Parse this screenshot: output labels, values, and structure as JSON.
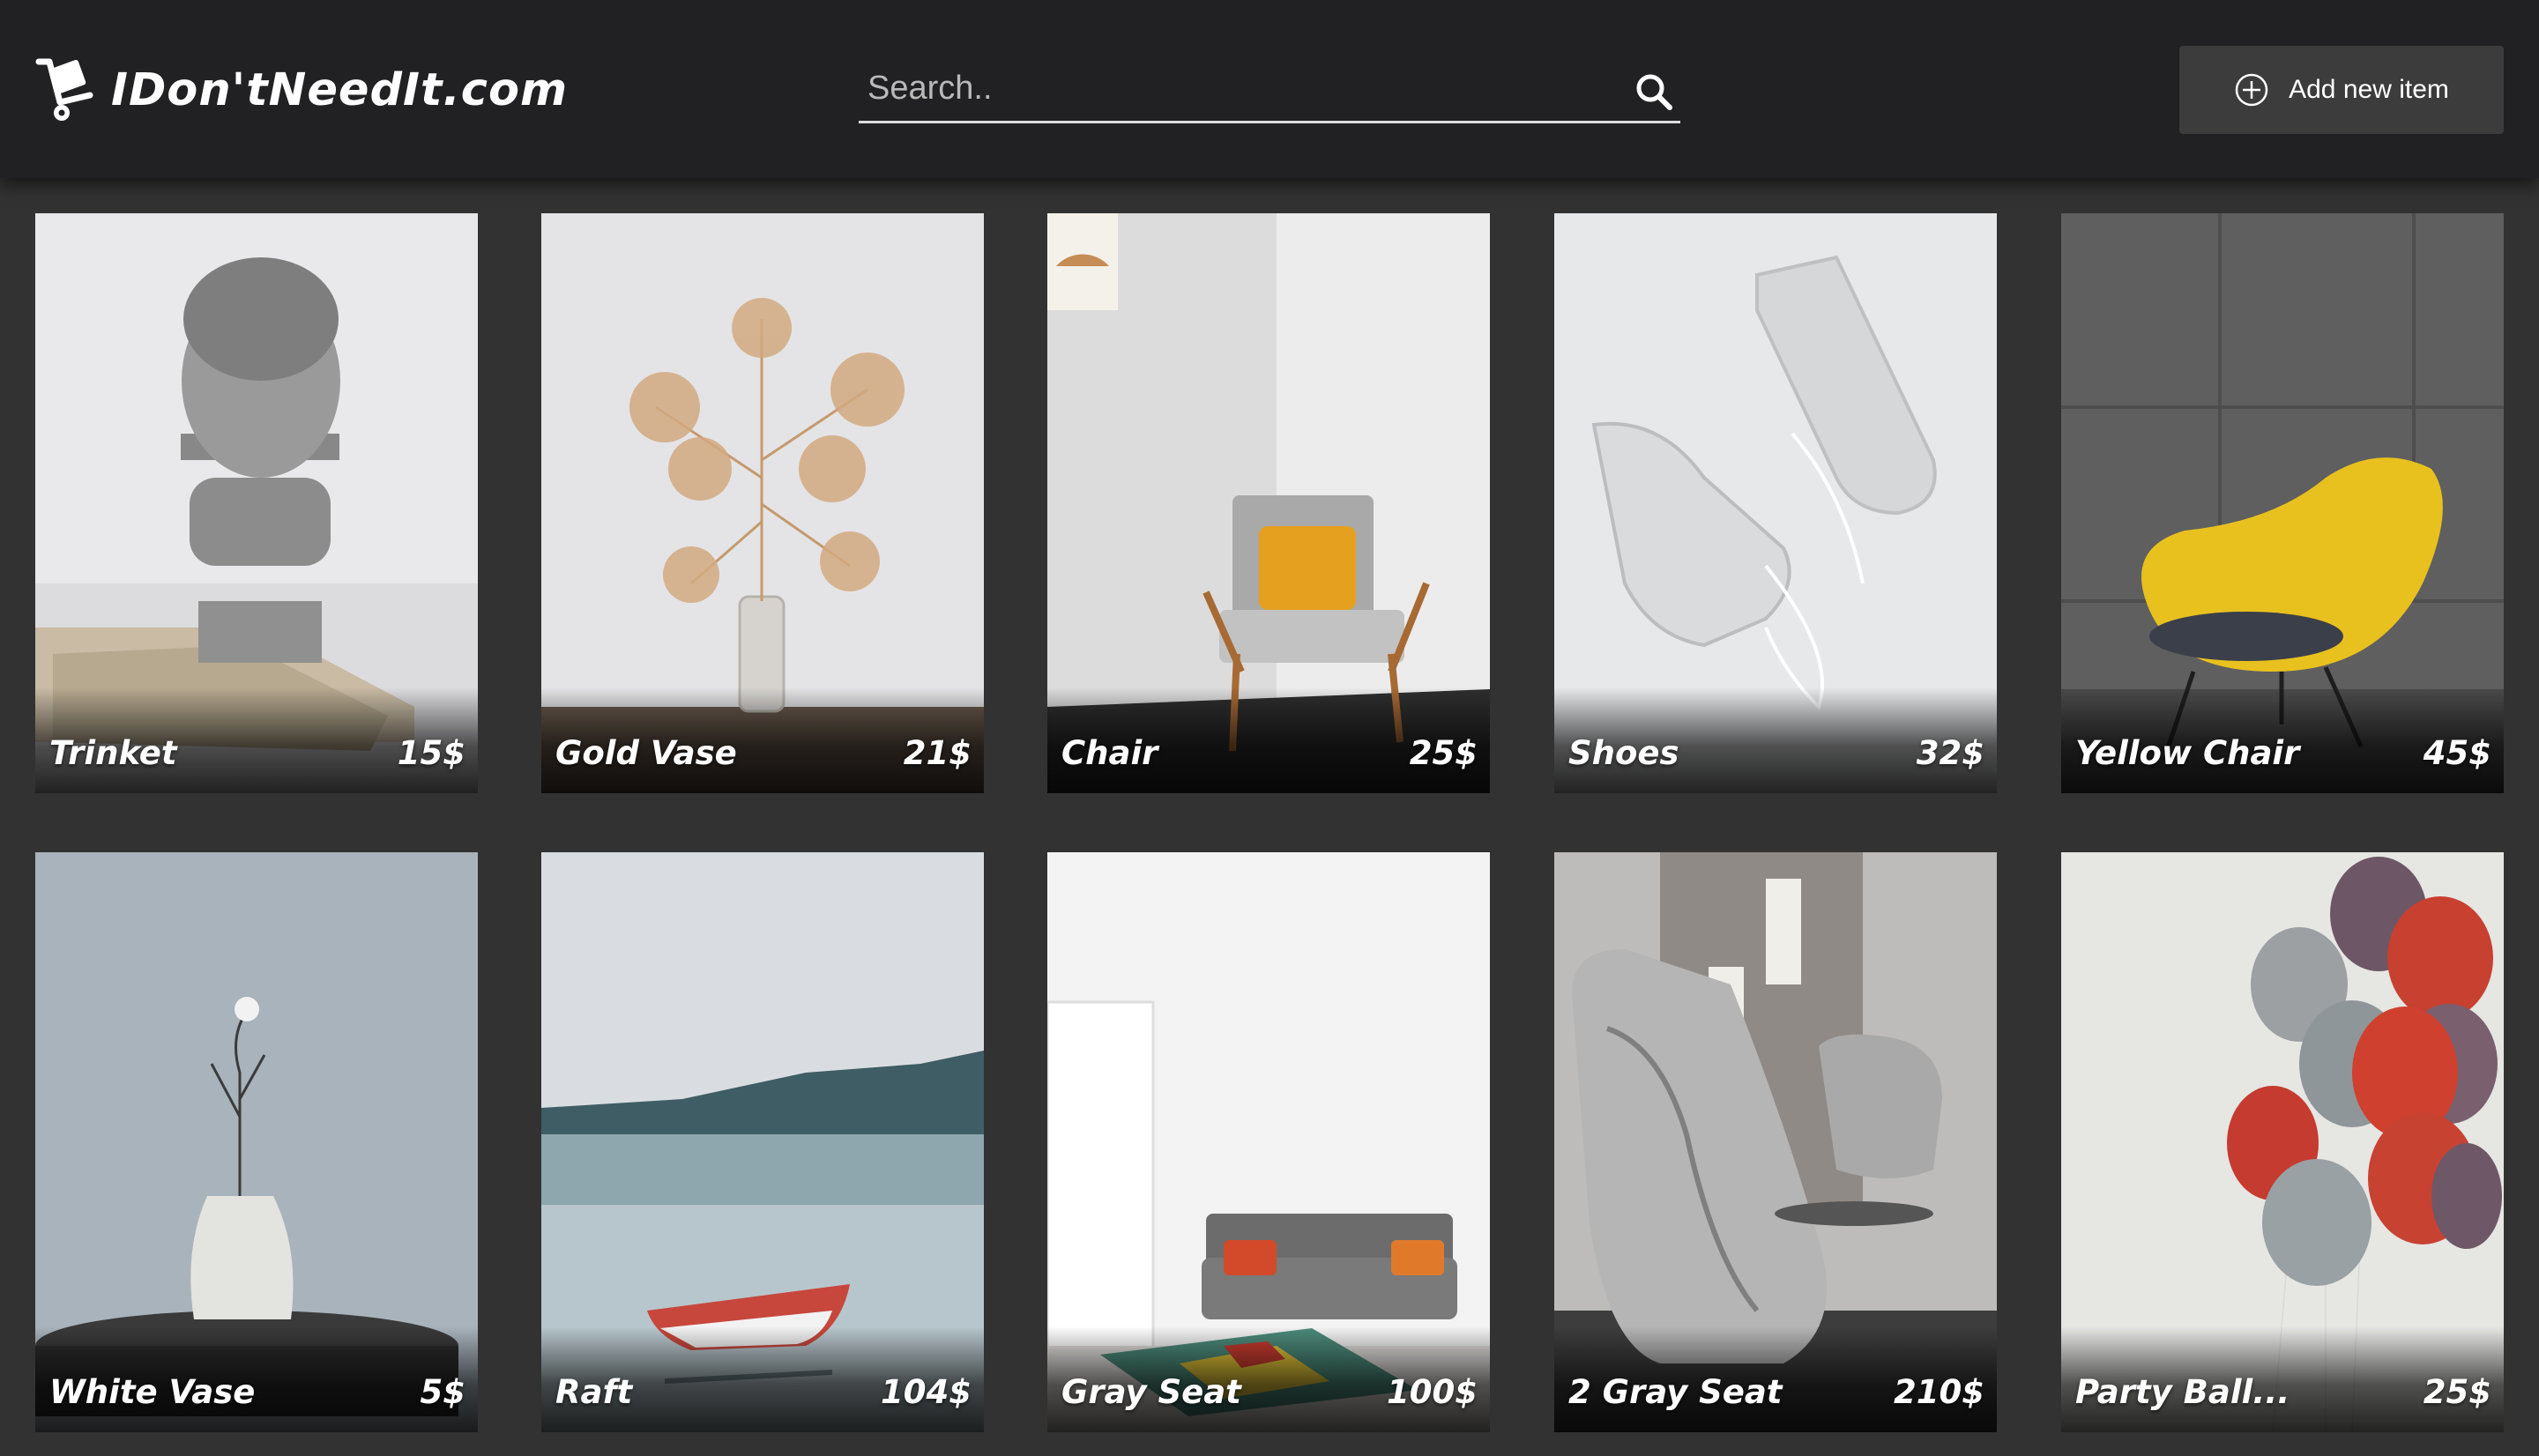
{
  "header": {
    "logo_text": "IDon'tNeedIt.com",
    "logo_icon": "hand-truck-box-icon",
    "search_placeholder": "Search..",
    "search_icon": "search-icon",
    "add_button_label": "Add new item",
    "add_button_icon": "plus-circle-icon"
  },
  "items": [
    {
      "name": "Trinket",
      "price": "15$"
    },
    {
      "name": "Gold Vase",
      "price": "21$"
    },
    {
      "name": "Chair",
      "price": "25$"
    },
    {
      "name": "Shoes",
      "price": "32$"
    },
    {
      "name": "Yellow Chair",
      "price": "45$"
    },
    {
      "name": "White Vase",
      "price": "5$"
    },
    {
      "name": "Raft",
      "price": "104$"
    },
    {
      "name": "Gray Seat",
      "price": "100$"
    },
    {
      "name": "2 Gray Seat",
      "price": "210$"
    },
    {
      "name": "Party Ball...",
      "price": "25$"
    }
  ],
  "colors": {
    "header_bg": "#212022",
    "page_bg": "#323232",
    "button_bg": "#3c3c3c",
    "text": "#ffffff"
  }
}
